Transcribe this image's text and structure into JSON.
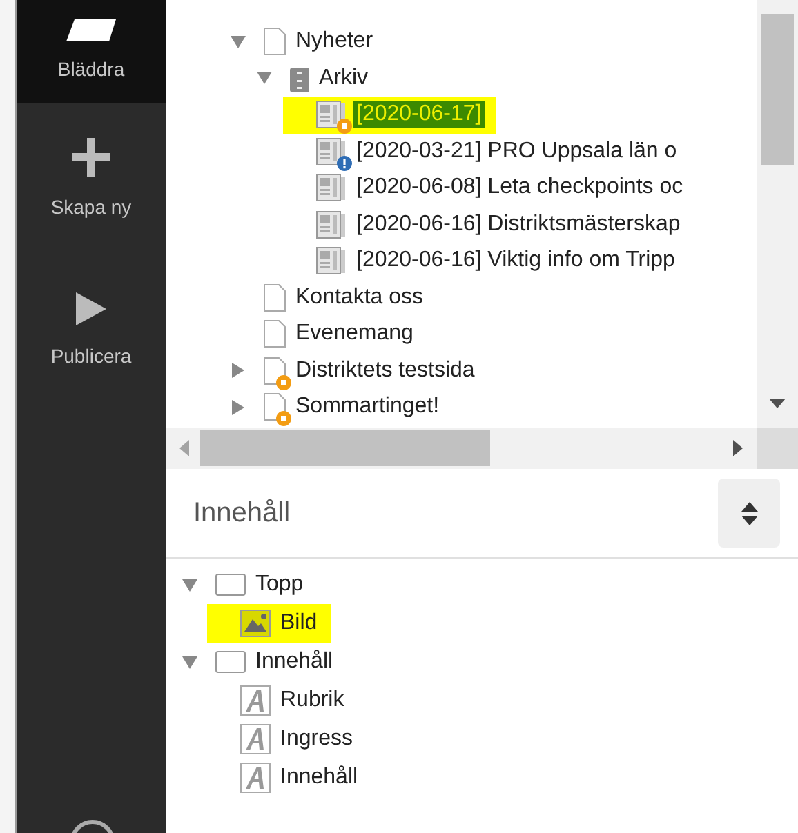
{
  "sidebar": {
    "items": [
      {
        "label": "Bläddra",
        "kind": "browse",
        "selected": true
      },
      {
        "label": "Skapa ny",
        "kind": "create",
        "selected": false
      },
      {
        "label": "Publicera",
        "kind": "publish",
        "selected": false
      }
    ]
  },
  "page_tree": [
    {
      "label": "Nyheter",
      "kind": "page",
      "expired": false,
      "expanded": true,
      "children": [
        {
          "label": "Arkiv",
          "kind": "archive",
          "expanded": true,
          "children": [
            {
              "label": "[2020-06-17]",
              "kind": "article",
              "expired": true,
              "notice": false,
              "selected": true,
              "highlighted": true
            },
            {
              "label": "[2020-03-21] PRO Uppsala län o",
              "kind": "article",
              "expired": false,
              "notice": true,
              "selected": false,
              "highlighted": false
            },
            {
              "label": "[2020-06-08] Leta checkpoints oc",
              "kind": "article",
              "expired": false,
              "notice": false,
              "selected": false,
              "highlighted": false
            },
            {
              "label": "[2020-06-16] Distriktsmästerskap",
              "kind": "article",
              "expired": false,
              "notice": false,
              "selected": false,
              "highlighted": false
            },
            {
              "label": "[2020-06-16] Viktig info om Tripp",
              "kind": "article",
              "expired": false,
              "notice": false,
              "selected": false,
              "highlighted": false
            }
          ]
        }
      ]
    },
    {
      "label": "Kontakta oss",
      "kind": "page",
      "expired": false
    },
    {
      "label": "Evenemang",
      "kind": "page",
      "expired": false
    },
    {
      "label": "Distriktets testsida",
      "kind": "page",
      "expired": true,
      "expanded": false
    },
    {
      "label": "Sommartinget!",
      "kind": "page",
      "expired": true,
      "expanded": false
    }
  ],
  "content_panel": {
    "title": "Innehåll",
    "tree": [
      {
        "label": "Topp",
        "kind": "area",
        "expanded": true,
        "children": [
          {
            "label": "Bild",
            "kind": "image",
            "highlighted": true
          }
        ]
      },
      {
        "label": "Innehåll",
        "kind": "area",
        "expanded": true,
        "children": [
          {
            "label": "Rubrik",
            "kind": "text",
            "highlighted": false
          },
          {
            "label": "Ingress",
            "kind": "text",
            "highlighted": false
          },
          {
            "label": "Innehåll",
            "kind": "text",
            "highlighted": false
          }
        ]
      }
    ]
  }
}
